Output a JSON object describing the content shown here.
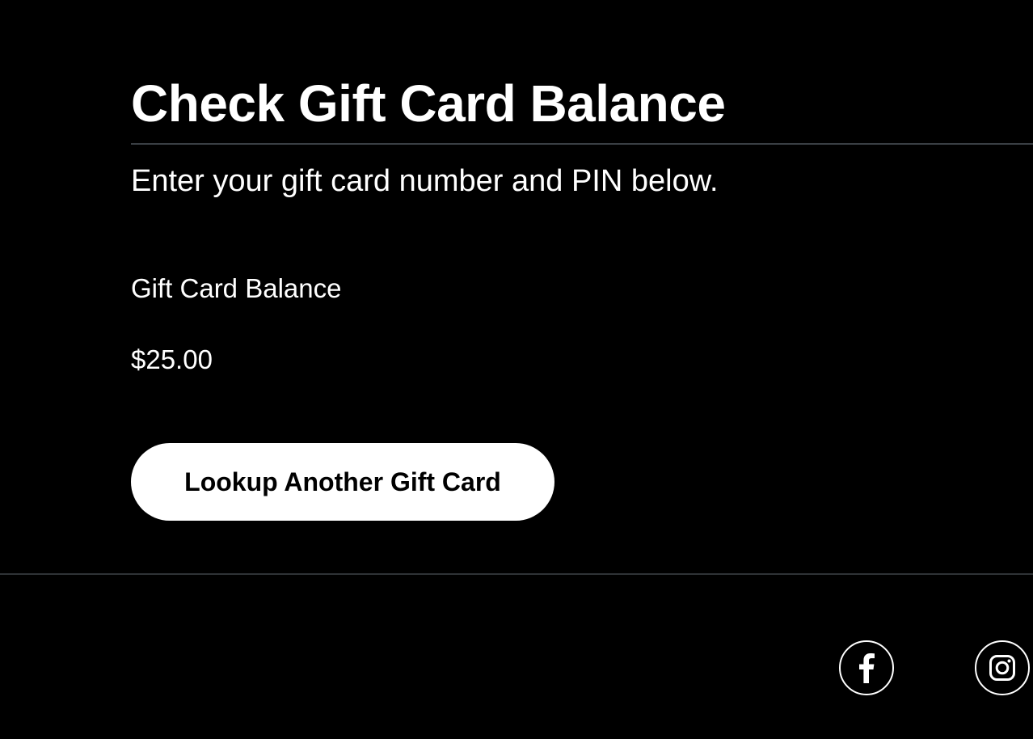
{
  "header": {
    "title": "Check Gift Card Balance",
    "subtitle": "Enter your gift card number and PIN below."
  },
  "balance": {
    "label": "Gift Card Balance",
    "value": "$25.00"
  },
  "actions": {
    "lookup_another_label": "Lookup Another Gift Card"
  },
  "footer": {
    "social": [
      {
        "icon": "facebook-icon"
      },
      {
        "icon": "instagram-icon"
      }
    ]
  },
  "colors": {
    "background": "#000000",
    "text": "#ffffff",
    "button_background": "#ffffff",
    "button_text": "#000000",
    "divider": "#3a3f44"
  }
}
